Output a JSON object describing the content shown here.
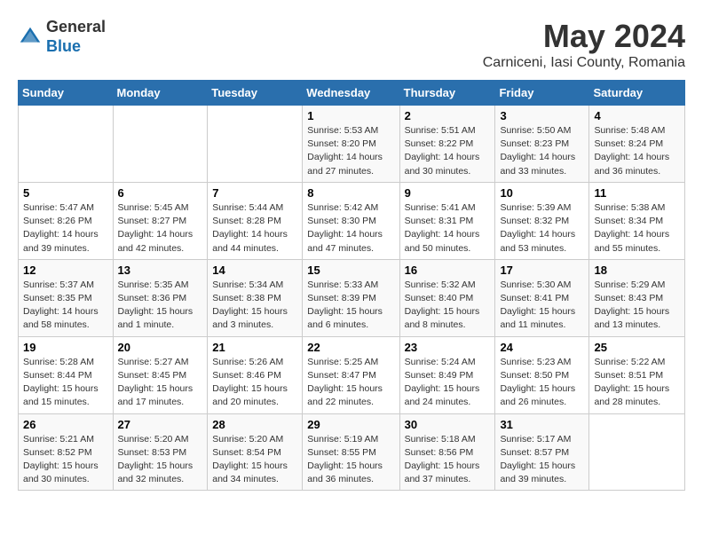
{
  "header": {
    "logo_line1": "General",
    "logo_line2": "Blue",
    "month": "May 2024",
    "location": "Carniceni, Iasi County, Romania"
  },
  "weekdays": [
    "Sunday",
    "Monday",
    "Tuesday",
    "Wednesday",
    "Thursday",
    "Friday",
    "Saturday"
  ],
  "weeks": [
    [
      {
        "day": "",
        "info": ""
      },
      {
        "day": "",
        "info": ""
      },
      {
        "day": "",
        "info": ""
      },
      {
        "day": "1",
        "info": "Sunrise: 5:53 AM\nSunset: 8:20 PM\nDaylight: 14 hours\nand 27 minutes."
      },
      {
        "day": "2",
        "info": "Sunrise: 5:51 AM\nSunset: 8:22 PM\nDaylight: 14 hours\nand 30 minutes."
      },
      {
        "day": "3",
        "info": "Sunrise: 5:50 AM\nSunset: 8:23 PM\nDaylight: 14 hours\nand 33 minutes."
      },
      {
        "day": "4",
        "info": "Sunrise: 5:48 AM\nSunset: 8:24 PM\nDaylight: 14 hours\nand 36 minutes."
      }
    ],
    [
      {
        "day": "5",
        "info": "Sunrise: 5:47 AM\nSunset: 8:26 PM\nDaylight: 14 hours\nand 39 minutes."
      },
      {
        "day": "6",
        "info": "Sunrise: 5:45 AM\nSunset: 8:27 PM\nDaylight: 14 hours\nand 42 minutes."
      },
      {
        "day": "7",
        "info": "Sunrise: 5:44 AM\nSunset: 8:28 PM\nDaylight: 14 hours\nand 44 minutes."
      },
      {
        "day": "8",
        "info": "Sunrise: 5:42 AM\nSunset: 8:30 PM\nDaylight: 14 hours\nand 47 minutes."
      },
      {
        "day": "9",
        "info": "Sunrise: 5:41 AM\nSunset: 8:31 PM\nDaylight: 14 hours\nand 50 minutes."
      },
      {
        "day": "10",
        "info": "Sunrise: 5:39 AM\nSunset: 8:32 PM\nDaylight: 14 hours\nand 53 minutes."
      },
      {
        "day": "11",
        "info": "Sunrise: 5:38 AM\nSunset: 8:34 PM\nDaylight: 14 hours\nand 55 minutes."
      }
    ],
    [
      {
        "day": "12",
        "info": "Sunrise: 5:37 AM\nSunset: 8:35 PM\nDaylight: 14 hours\nand 58 minutes."
      },
      {
        "day": "13",
        "info": "Sunrise: 5:35 AM\nSunset: 8:36 PM\nDaylight: 15 hours\nand 1 minute."
      },
      {
        "day": "14",
        "info": "Sunrise: 5:34 AM\nSunset: 8:38 PM\nDaylight: 15 hours\nand 3 minutes."
      },
      {
        "day": "15",
        "info": "Sunrise: 5:33 AM\nSunset: 8:39 PM\nDaylight: 15 hours\nand 6 minutes."
      },
      {
        "day": "16",
        "info": "Sunrise: 5:32 AM\nSunset: 8:40 PM\nDaylight: 15 hours\nand 8 minutes."
      },
      {
        "day": "17",
        "info": "Sunrise: 5:30 AM\nSunset: 8:41 PM\nDaylight: 15 hours\nand 11 minutes."
      },
      {
        "day": "18",
        "info": "Sunrise: 5:29 AM\nSunset: 8:43 PM\nDaylight: 15 hours\nand 13 minutes."
      }
    ],
    [
      {
        "day": "19",
        "info": "Sunrise: 5:28 AM\nSunset: 8:44 PM\nDaylight: 15 hours\nand 15 minutes."
      },
      {
        "day": "20",
        "info": "Sunrise: 5:27 AM\nSunset: 8:45 PM\nDaylight: 15 hours\nand 17 minutes."
      },
      {
        "day": "21",
        "info": "Sunrise: 5:26 AM\nSunset: 8:46 PM\nDaylight: 15 hours\nand 20 minutes."
      },
      {
        "day": "22",
        "info": "Sunrise: 5:25 AM\nSunset: 8:47 PM\nDaylight: 15 hours\nand 22 minutes."
      },
      {
        "day": "23",
        "info": "Sunrise: 5:24 AM\nSunset: 8:49 PM\nDaylight: 15 hours\nand 24 minutes."
      },
      {
        "day": "24",
        "info": "Sunrise: 5:23 AM\nSunset: 8:50 PM\nDaylight: 15 hours\nand 26 minutes."
      },
      {
        "day": "25",
        "info": "Sunrise: 5:22 AM\nSunset: 8:51 PM\nDaylight: 15 hours\nand 28 minutes."
      }
    ],
    [
      {
        "day": "26",
        "info": "Sunrise: 5:21 AM\nSunset: 8:52 PM\nDaylight: 15 hours\nand 30 minutes."
      },
      {
        "day": "27",
        "info": "Sunrise: 5:20 AM\nSunset: 8:53 PM\nDaylight: 15 hours\nand 32 minutes."
      },
      {
        "day": "28",
        "info": "Sunrise: 5:20 AM\nSunset: 8:54 PM\nDaylight: 15 hours\nand 34 minutes."
      },
      {
        "day": "29",
        "info": "Sunrise: 5:19 AM\nSunset: 8:55 PM\nDaylight: 15 hours\nand 36 minutes."
      },
      {
        "day": "30",
        "info": "Sunrise: 5:18 AM\nSunset: 8:56 PM\nDaylight: 15 hours\nand 37 minutes."
      },
      {
        "day": "31",
        "info": "Sunrise: 5:17 AM\nSunset: 8:57 PM\nDaylight: 15 hours\nand 39 minutes."
      },
      {
        "day": "",
        "info": ""
      }
    ]
  ]
}
